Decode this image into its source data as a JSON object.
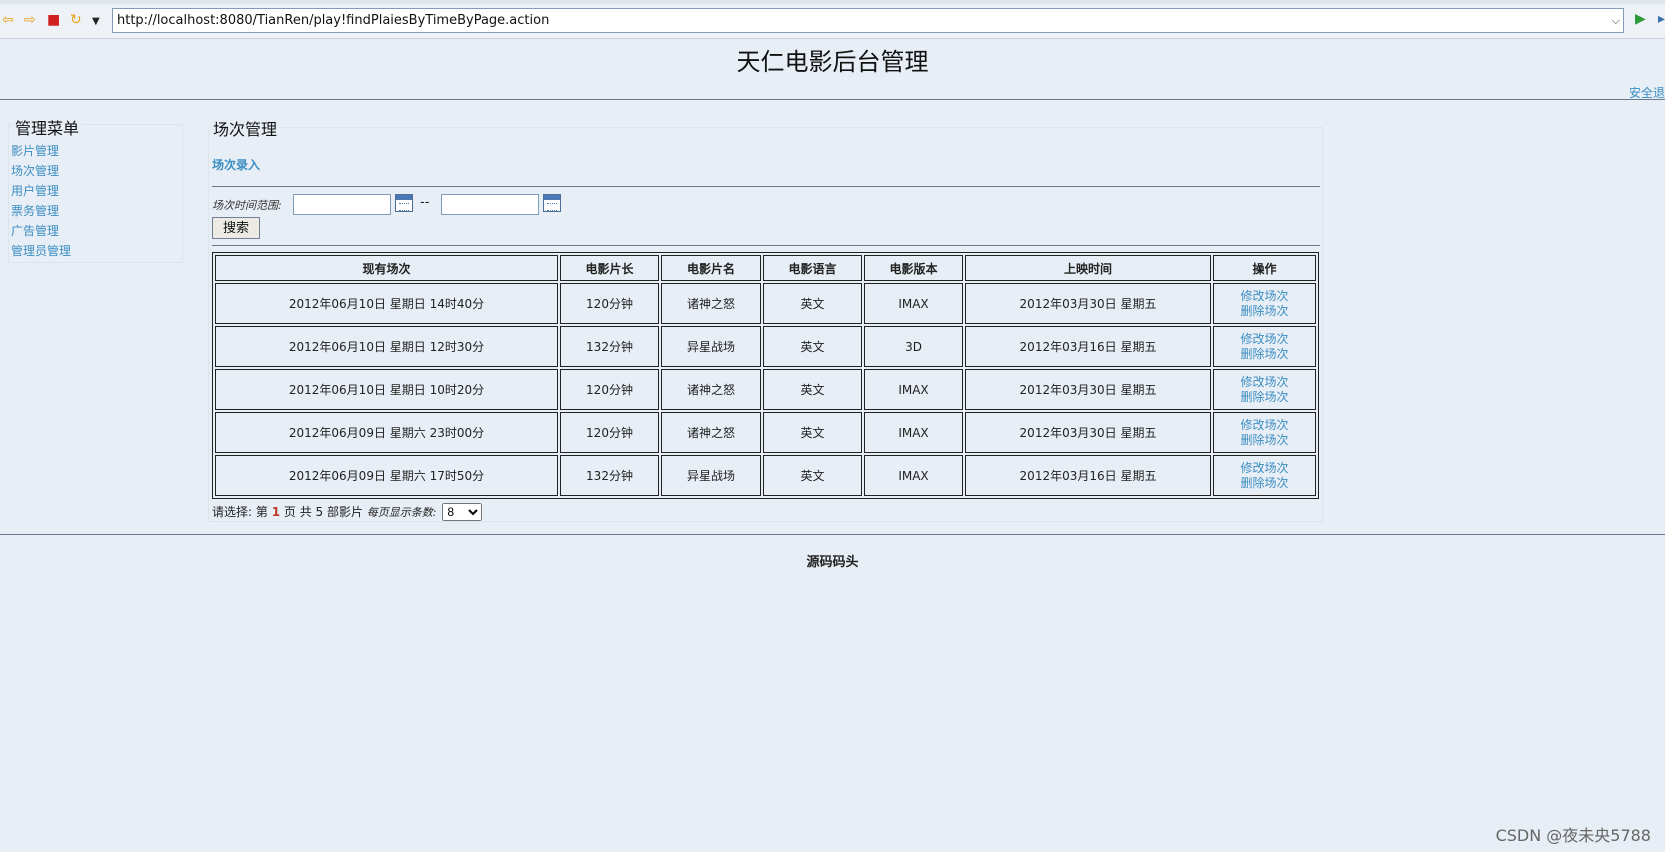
{
  "browser": {
    "url": "http://localhost:8080/TianRen/play!findPlaiesByTimeByPage.action"
  },
  "header": {
    "title": "天仁电影后台管理",
    "logout": "安全退"
  },
  "sidebar": {
    "title": "管理菜单",
    "items": [
      {
        "label": "影片管理"
      },
      {
        "label": "场次管理"
      },
      {
        "label": "用户管理"
      },
      {
        "label": "票务管理"
      },
      {
        "label": "广告管理"
      },
      {
        "label": "管理员管理"
      }
    ]
  },
  "main": {
    "title": "场次管理",
    "add_link": "场次录入",
    "range_label": "场次时间范围:",
    "range_separator": "--",
    "start_date": "",
    "end_date": "",
    "search_label": "搜索"
  },
  "table": {
    "headers": [
      "现有场次",
      "电影片长",
      "电影片名",
      "电影语言",
      "电影版本",
      "上映时间",
      "操作"
    ],
    "rows": [
      {
        "session": "2012年06月10日 星期日 14时40分",
        "length": "120分钟",
        "name": "诸神之怒",
        "language": "英文",
        "version": "IMAX",
        "release": "2012年03月30日 星期五",
        "edit": "修改场次",
        "delete": "删除场次"
      },
      {
        "session": "2012年06月10日 星期日 12时30分",
        "length": "132分钟",
        "name": "异星战场",
        "language": "英文",
        "version": "3D",
        "release": "2012年03月16日 星期五",
        "edit": "修改场次",
        "delete": "删除场次"
      },
      {
        "session": "2012年06月10日 星期日 10时20分",
        "length": "120分钟",
        "name": "诸神之怒",
        "language": "英文",
        "version": "IMAX",
        "release": "2012年03月30日 星期五",
        "edit": "修改场次",
        "delete": "删除场次"
      },
      {
        "session": "2012年06月09日 星期六 23时00分",
        "length": "120分钟",
        "name": "诸神之怒",
        "language": "英文",
        "version": "IMAX",
        "release": "2012年03月30日 星期五",
        "edit": "修改场次",
        "delete": "删除场次"
      },
      {
        "session": "2012年06月09日 星期六 17时50分",
        "length": "132分钟",
        "name": "异星战场",
        "language": "英文",
        "version": "IMAX",
        "release": "2012年03月16日 星期五",
        "edit": "修改场次",
        "delete": "删除场次"
      }
    ]
  },
  "pager": {
    "prefix": "请选择: 第",
    "current_page": "1",
    "middle": "页 共 5 部影片",
    "per_page_label": "每页显示条数:",
    "per_page_value": "8"
  },
  "footer": {
    "text": "源码码头"
  },
  "watermark": "CSDN @夜未央5788",
  "colors": {
    "link": "#3b8ec2",
    "background": "#e8eef5",
    "current_page": "#c0392b"
  }
}
